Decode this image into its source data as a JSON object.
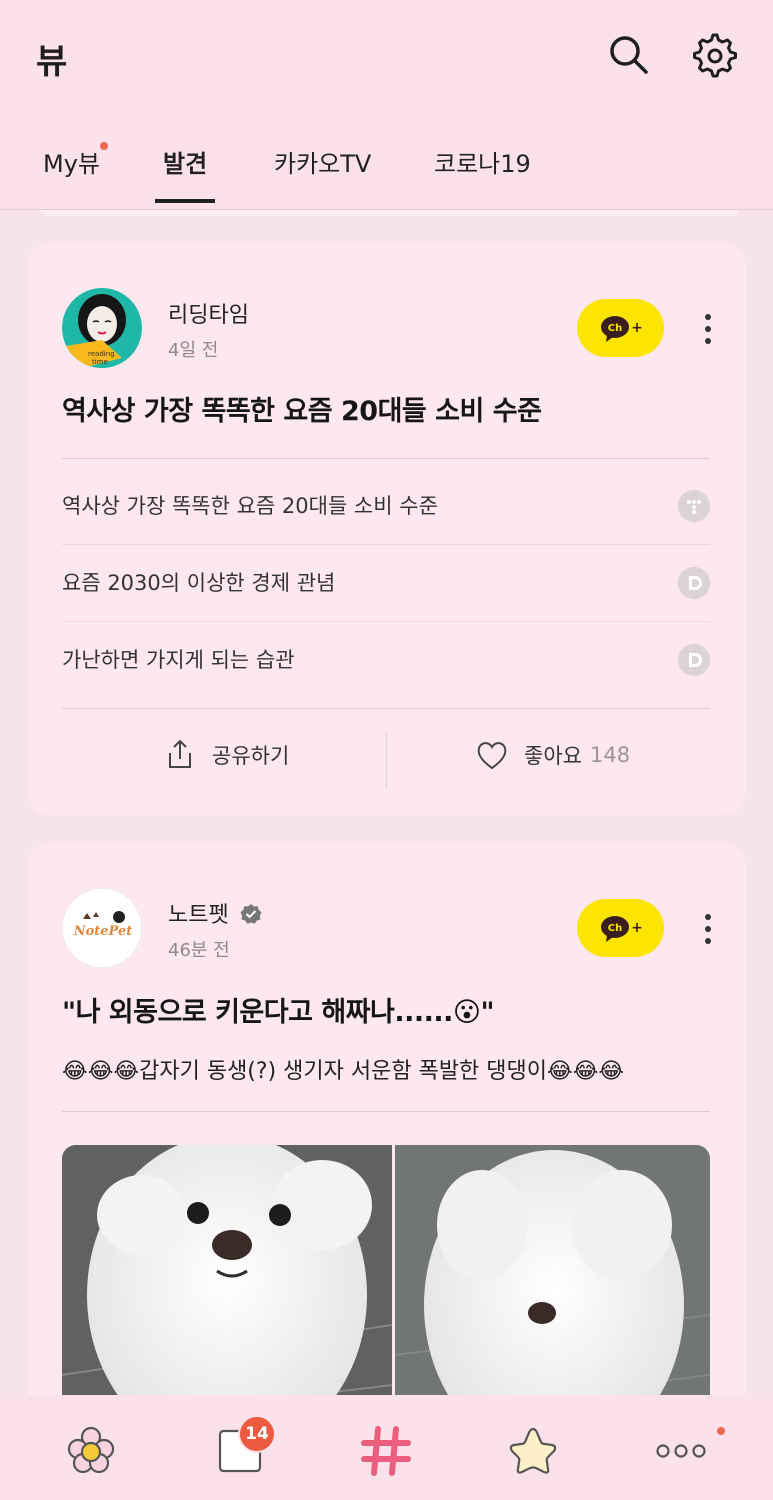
{
  "header": {
    "title": "뷰",
    "search_icon": "search-icon",
    "settings_icon": "gear-icon"
  },
  "tabs": [
    {
      "label": "My뷰",
      "has_dot": true,
      "active": false
    },
    {
      "label": "발견",
      "active": true
    },
    {
      "label": "카카오TV",
      "active": false
    },
    {
      "label": "코로나19",
      "active": false
    }
  ],
  "cards": [
    {
      "channel_name": "리딩타임",
      "time": "4일 전",
      "channel_button": "Ch+",
      "title": "역사상 가장 똑똑한 요즘 20대들 소비 수준",
      "items": [
        {
          "text": "역사상 가장 똑똑한 요즘 20대들 소비 수준",
          "source_icon": "tistory-icon"
        },
        {
          "text": "요즘 2030의 이상한 경제 관념",
          "source_icon": "daum-icon"
        },
        {
          "text": "가난하면 가지게 되는 습관",
          "source_icon": "daum-icon"
        }
      ],
      "share_label": "공유하기",
      "like_label": "좋아요",
      "like_count": "148"
    },
    {
      "channel_name": "노트펫",
      "verified": true,
      "time": "46분 전",
      "channel_button": "Ch+",
      "title": "\"나 외동으로 키운다고 해짜나......😮\"",
      "description": "😂😂😂갑자기 동생(?) 생기자 서운함 폭발한 댕댕이😂😂😂"
    }
  ],
  "bottom_nav": [
    {
      "icon": "flower-icon"
    },
    {
      "icon": "chat-bubble-icon",
      "badge": "14"
    },
    {
      "icon": "hashtag-icon"
    },
    {
      "icon": "star-icon"
    },
    {
      "icon": "more-dots-icon",
      "has_dot": true
    }
  ],
  "colors": {
    "background": "#f7e3ea",
    "card": "#fde8ef",
    "channel_button": "#fee500",
    "badge": "#ec5a3f"
  }
}
